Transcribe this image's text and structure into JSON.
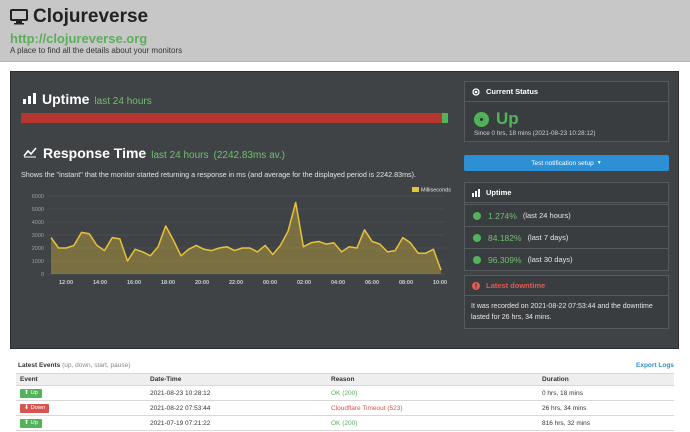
{
  "header": {
    "title": "Clojureverse",
    "url": "http://clojureverse.org",
    "tagline": "A place to find all the details about your monitors"
  },
  "uptime_section": {
    "title": "Uptime",
    "period": "last 24 hours",
    "uptime_fraction": 0.01274
  },
  "response_section": {
    "title": "Response Time",
    "period": "last 24 hours",
    "average": "(2242.83ms av.)",
    "description": "Shows the \"instant\" that the monitor started returning a response in ms (and average for the displayed period is 2242.83ms)."
  },
  "chart_data": {
    "type": "area",
    "legend": [
      "Milliseconds"
    ],
    "legend_position": "top-right",
    "series_color": "#e8c23a",
    "ylim": [
      0,
      6000
    ],
    "yticks": [
      "6000",
      "5000",
      "4000",
      "3000",
      "2000",
      "1000",
      "0"
    ],
    "xticks": [
      "12:00",
      "14:00",
      "16:00",
      "18:00",
      "20:00",
      "22:00",
      "00:00",
      "02:00",
      "04:00",
      "06:00",
      "08:00",
      "10:00"
    ],
    "series": [
      {
        "values": [
          2800,
          2000,
          2000,
          2200,
          3200,
          3100,
          2200,
          1800,
          2800,
          2700,
          1000,
          1900,
          1700,
          1400,
          2100,
          3700,
          2600,
          1400,
          1900,
          2200,
          1900,
          1800,
          2000,
          2100,
          1800,
          2000,
          2000,
          1700,
          2200,
          1500,
          2200,
          3300,
          5500,
          2100,
          2400,
          2500,
          2300,
          2400,
          1700,
          2100,
          2000,
          3400,
          2500,
          2300,
          1700,
          1800,
          2800,
          2400,
          1600,
          1600,
          1900,
          300
        ]
      }
    ]
  },
  "current_status": {
    "title": "Current Status",
    "status": "Up",
    "since": "Since 0 hrs, 18 mins (2021-08-23 10:28:12)"
  },
  "test_button": {
    "label": "Test notification setup"
  },
  "uptime_card": {
    "title": "Uptime",
    "rows": [
      {
        "value": "1.274%",
        "period": "(last 24 hours)"
      },
      {
        "value": "84.182%",
        "period": "(last 7 days)"
      },
      {
        "value": "96.309%",
        "period": "(last 30 days)"
      }
    ]
  },
  "downtime": {
    "title": "Latest downtime",
    "text": "It was recorded on 2021-08-22 07:53:44 and the downtime lasted for 26 hrs, 34 mins."
  },
  "events": {
    "title": "Latest Events",
    "filter": "(up, down, start, pause)",
    "export_label": "Export Logs",
    "columns": [
      "Event",
      "Date-Time",
      "Reason",
      "Duration"
    ],
    "rows": [
      {
        "event": "Up",
        "datetime": "2021-08-23 10:28:12",
        "reason": "OK (200)",
        "duration": "0 hrs, 18 mins"
      },
      {
        "event": "Down",
        "datetime": "2021-08-22 07:53:44",
        "reason": "Cloudflare Timeout (523)",
        "duration": "26 hrs, 34 mins"
      },
      {
        "event": "Up",
        "datetime": "2021-07-19 07:21:22",
        "reason": "OK (200)",
        "duration": "816 hrs, 32 mins"
      }
    ]
  },
  "colors": {
    "up": "#52b35a",
    "down": "#d9534f",
    "link": "#2d8fd4",
    "panel": "#3f4346"
  }
}
